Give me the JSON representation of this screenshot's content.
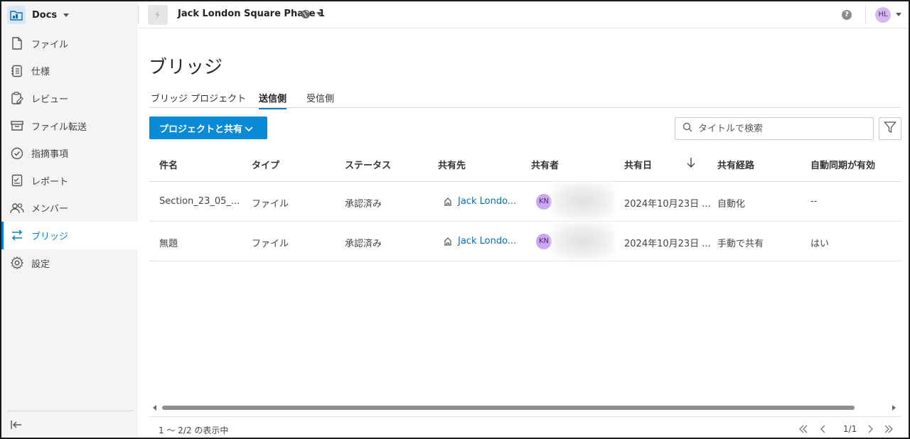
{
  "sidebar": {
    "app_name": "Docs",
    "items": [
      {
        "label": "ファイル",
        "icon": "file-icon"
      },
      {
        "label": "仕様",
        "icon": "spec-icon"
      },
      {
        "label": "レビュー",
        "icon": "review-icon"
      },
      {
        "label": "ファイル転送",
        "icon": "transfer-icon"
      },
      {
        "label": "指摘事項",
        "icon": "issues-icon"
      },
      {
        "label": "レポート",
        "icon": "report-icon"
      },
      {
        "label": "メンバー",
        "icon": "members-icon"
      },
      {
        "label": "ブリッジ",
        "icon": "bridge-icon",
        "active": true
      },
      {
        "label": "設定",
        "icon": "gear-icon"
      }
    ]
  },
  "topbar": {
    "project_name": "Jack London Square Phase 1",
    "help": "?",
    "user_initials": "HL"
  },
  "page": {
    "title": "ブリッジ",
    "tabs": [
      {
        "label": "ブリッジ プロジェクト",
        "active": false
      },
      {
        "label": "送信側",
        "active": true
      },
      {
        "label": "受信側",
        "active": false
      }
    ],
    "share_button": "プロジェクトと共有",
    "search_placeholder": "タイトルで検索"
  },
  "table": {
    "headers": [
      "件名",
      "タイプ",
      "ステータス",
      "共有先",
      "共有者",
      "共有日",
      "共有経路",
      "自動同期が有効"
    ],
    "sort_column": "共有日",
    "rows": [
      {
        "name": "Section_23_05_...",
        "type": "ファイル",
        "status": "承認済み",
        "shared_to": "Jack Londo...",
        "sharer_initials": "KN",
        "date": "2024年10月23日 ...",
        "route": "自動化",
        "auto_sync": "--"
      },
      {
        "name": "無題",
        "type": "ファイル",
        "status": "承認済み",
        "shared_to": "Jack Londo...",
        "sharer_initials": "KN",
        "date": "2024年10月23日 ...",
        "route": "手動で共有",
        "auto_sync": "はい"
      }
    ]
  },
  "footer": {
    "count_text": "1 ～ 2/2 の表示中",
    "page_text": "1/1"
  },
  "colors": {
    "accent": "#0a80c8",
    "button": "#0a8ad6",
    "sidebar_bg": "#f4f4f4",
    "avatar": "#d5b8f0"
  }
}
